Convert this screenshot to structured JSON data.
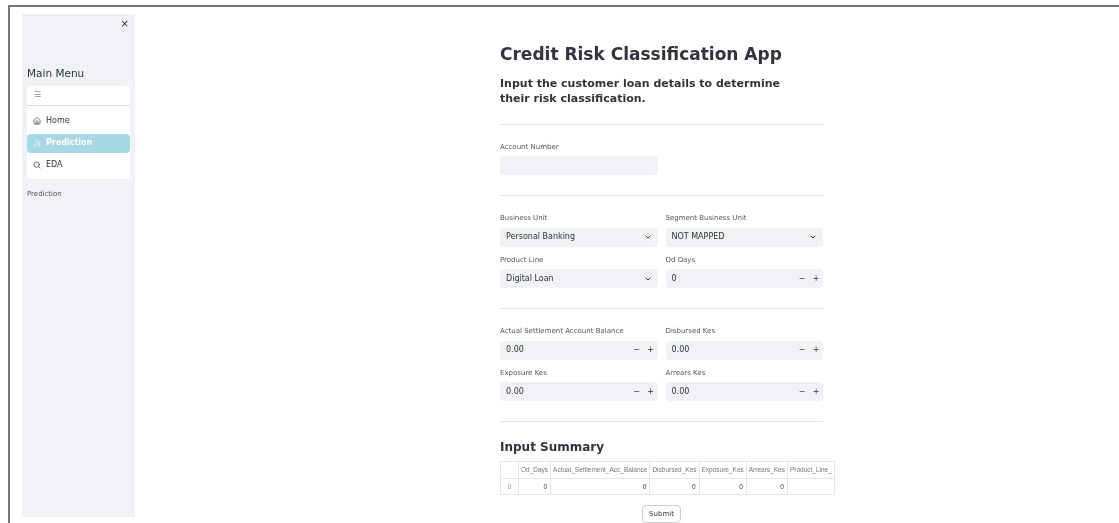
{
  "sidebar": {
    "close": "×",
    "title": "Main Menu",
    "menu_icon": "☰",
    "items": [
      {
        "label": "Home",
        "selected": false
      },
      {
        "label": "Prediction",
        "selected": true
      },
      {
        "label": "EDA",
        "selected": false
      }
    ],
    "caption": "Prediction"
  },
  "main": {
    "title": "Credit Risk Classification App",
    "subtitle": "Input the customer loan details to determine their risk classification.",
    "sections": [
      {
        "fields": [
          {
            "kind": "text",
            "label": "Account Number"
          }
        ]
      },
      {
        "fields": [
          {
            "kind": "select",
            "label": "Business Unit",
            "value": "Personal Banking"
          },
          {
            "kind": "select",
            "label": "Segment Business Unit",
            "value": "NOT MAPPED"
          },
          {
            "kind": "select",
            "label": "Product Line",
            "value": "Digital Loan"
          },
          {
            "kind": "number",
            "label": "Od Days",
            "value": "0",
            "decrement": "−",
            "increment": "+"
          }
        ]
      },
      {
        "fields": [
          {
            "kind": "number",
            "label": "Actual Settlement Account Balance",
            "value": "0.00",
            "decrement": "−",
            "increment": "+"
          },
          {
            "kind": "number",
            "label": "Disbursed Kes",
            "value": "0.00",
            "decrement": "−",
            "increment": "+"
          },
          {
            "kind": "number",
            "label": "Exposure Kes",
            "value": "0.00",
            "decrement": "−",
            "increment": "+"
          },
          {
            "kind": "number",
            "label": "Arrears Kes",
            "value": "0.00",
            "decrement": "−",
            "increment": "+"
          }
        ]
      }
    ],
    "summary": {
      "title": "Input Summary",
      "columns": [
        "Od_Days",
        "Actual_Settlement_Acc_Balance",
        "Disbursed_Kes",
        "Exposure_Kes",
        "Arrears_Kes",
        "Product_Line_"
      ],
      "rows": [
        {
          "index": "0",
          "cells": [
            "0",
            "0",
            "0",
            "0",
            "0"
          ]
        }
      ]
    },
    "submit": "Submit"
  }
}
